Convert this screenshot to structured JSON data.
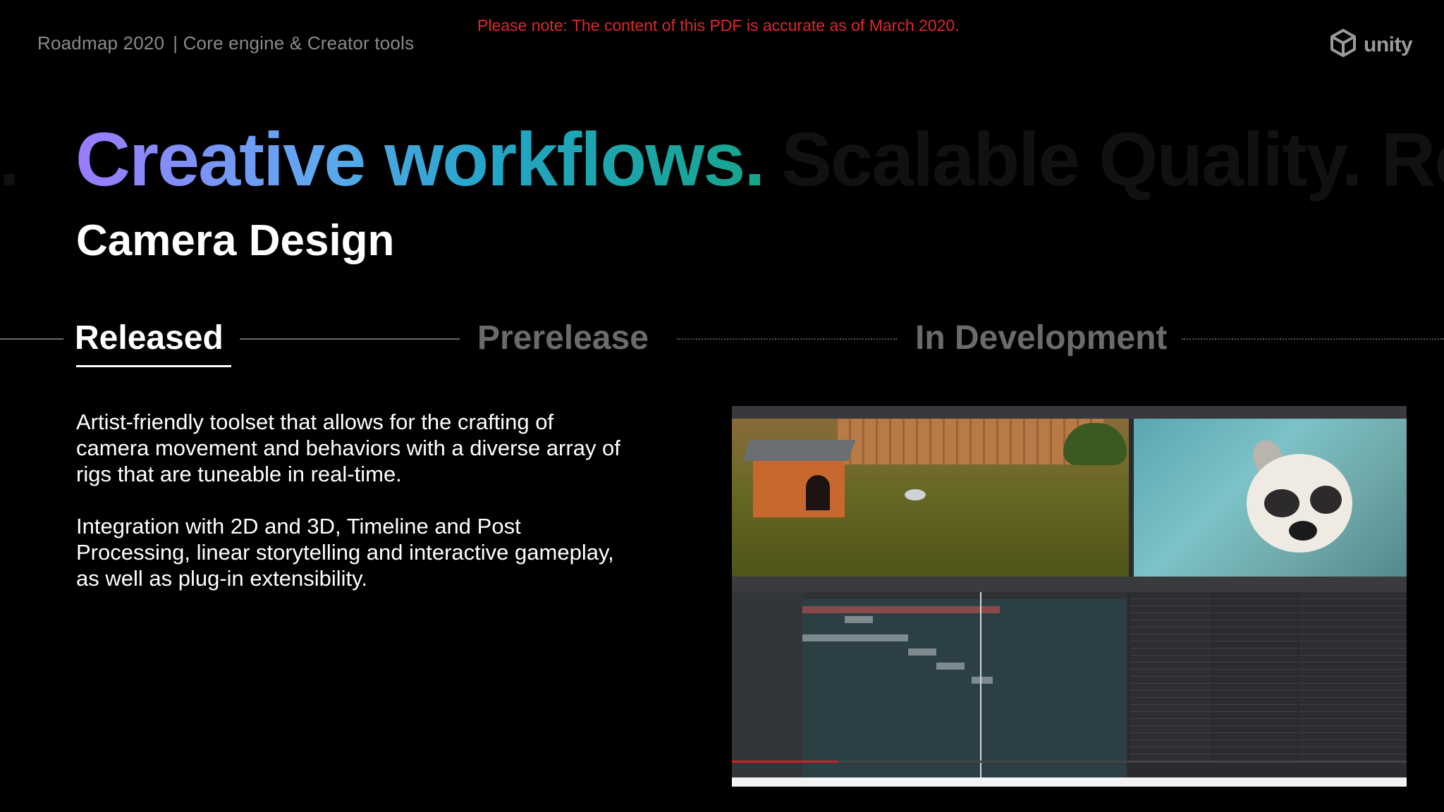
{
  "header": {
    "breadcrumb_main": "Roadmap 2020",
    "breadcrumb_section": "| Core engine & Creator tools",
    "notice": "Please note: The content of this PDF is accurate as of March 2020.",
    "brand": "unity",
    "brand_icon": "unity-logo-icon"
  },
  "hero": {
    "ghost_left": "e.",
    "headline": "Creative workflows.",
    "ghost_right": "Scalable Quality.  Re",
    "subtitle": "Camera Design"
  },
  "stages": {
    "active": "Released",
    "prerelease": "Prerelease",
    "in_development": "In Development"
  },
  "description": {
    "paragraph_1": "Artist-friendly toolset that allows for the crafting of camera movement and behaviors with a diverse array of rigs that are tuneable in real-time.",
    "paragraph_2": "Integration with 2D and 3D, Timeline and Post Processing, linear storytelling and interactive gameplay, as well as plug-in extensibility."
  },
  "colors": {
    "notice": "#e0262b",
    "gradient_start": "#9a7bff",
    "gradient_end": "#16a58a",
    "inactive_stage": "#6b6b6b"
  }
}
